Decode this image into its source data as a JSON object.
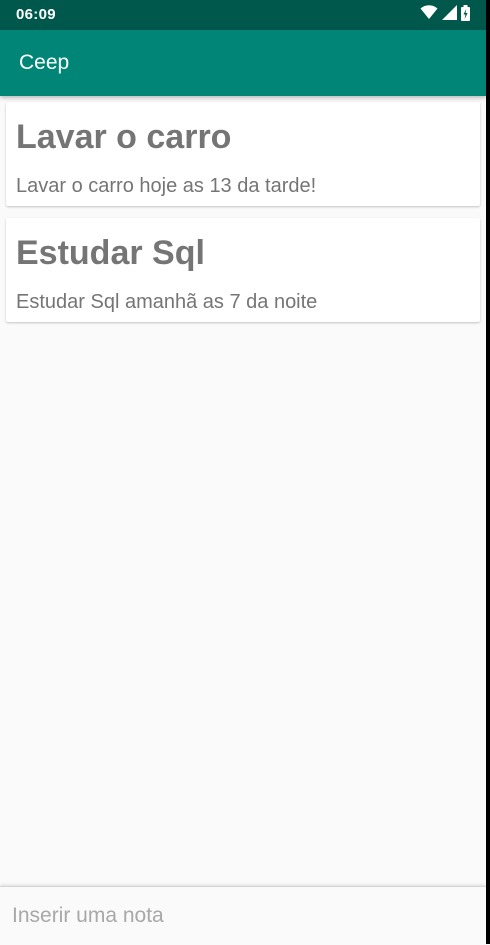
{
  "status_bar": {
    "time": "06:09",
    "icons": [
      "wifi-icon",
      "signal-icon",
      "battery-icon"
    ]
  },
  "app_bar": {
    "title": "Ceep"
  },
  "notes": [
    {
      "title": "Lavar o carro",
      "description": "Lavar o carro hoje as 13 da tarde!"
    },
    {
      "title": "Estudar Sql",
      "description": "Estudar Sql amanhã as 7 da noite"
    }
  ],
  "input": {
    "placeholder": "Inserir uma nota",
    "value": ""
  },
  "colors": {
    "status_bar": "#00574b",
    "app_bar": "#008577",
    "background": "#fafafa",
    "card": "#ffffff",
    "text_gray": "#757575"
  }
}
